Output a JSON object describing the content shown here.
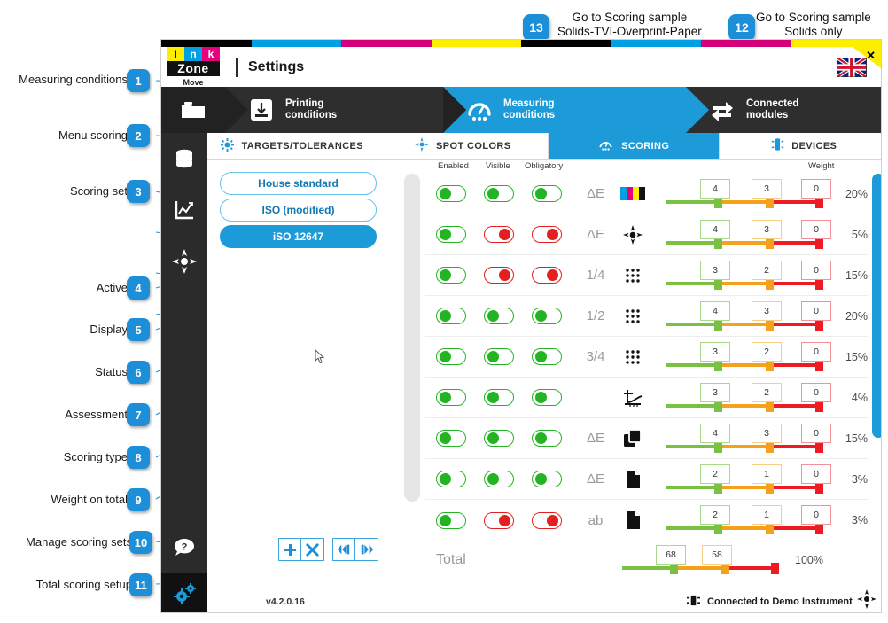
{
  "annotations": {
    "left_items": [
      {
        "n": "1",
        "label": "Measuring conditions"
      },
      {
        "n": "2",
        "label": "Menu scoring"
      },
      {
        "n": "3",
        "label": "Scoring set"
      },
      {
        "n": "4",
        "label": "Active"
      },
      {
        "n": "5",
        "label": "Display"
      },
      {
        "n": "6",
        "label": "Status"
      },
      {
        "n": "7",
        "label": "Assessment"
      },
      {
        "n": "8",
        "label": "Scoring type"
      },
      {
        "n": "9",
        "label": "Weight on total"
      },
      {
        "n": "10",
        "label": "Manage scoring sets"
      },
      {
        "n": "11",
        "label": "Total scoring setup"
      }
    ],
    "callouts": [
      {
        "n": "13",
        "line1": "Go to Scoring sample",
        "line2": "Solids-TVI-Overprint-Paper"
      },
      {
        "n": "12",
        "line1": "Go to Scoring sample",
        "line2": "Solids only"
      }
    ]
  },
  "window": {
    "logo": {
      "i": "I",
      "n": "n",
      "k": "k",
      "word": "Zone",
      "sub": "Move"
    },
    "title": "Settings",
    "flag_icon": "uk-flag-icon",
    "close_icon": "close-icon"
  },
  "mainnav": {
    "folder_icon": "folder-icon",
    "items": [
      {
        "label_1": "Printing",
        "label_2": "conditions",
        "icon": "printing-conditions-icon",
        "active": false
      },
      {
        "label_1": "Measuring",
        "label_2": "conditions",
        "icon": "measuring-conditions-icon",
        "active": true
      },
      {
        "label_1": "Connected",
        "label_2": "modules",
        "icon": "connected-modules-icon",
        "active": false
      }
    ]
  },
  "rail": {
    "icons": [
      "folder-icon",
      "database-icon",
      "chart-icon",
      "target-icon",
      "help-icon",
      "gears-icon"
    ]
  },
  "subtabs": [
    {
      "label": "TARGETS/TOLERANCES",
      "icon": "targets-tolerances-icon",
      "active": false
    },
    {
      "label": "SPOT COLORS",
      "icon": "spot-colors-icon",
      "active": false
    },
    {
      "label": "SCORING",
      "icon": "scoring-icon",
      "active": true
    },
    {
      "label": "DEVICES",
      "icon": "devices-icon",
      "active": false
    }
  ],
  "scoring_sets": [
    {
      "label": "House standard",
      "selected": false
    },
    {
      "label": "ISO (modified)",
      "selected": false
    },
    {
      "label": "iSO 12647",
      "selected": true
    }
  ],
  "manage_buttons": [
    {
      "name": "add-scoring-set-button",
      "glyph": "+"
    },
    {
      "name": "delete-scoring-set-button",
      "glyph": "✕"
    },
    {
      "name": "import-scoring-set-button",
      "glyph": "import"
    },
    {
      "name": "export-scoring-set-button",
      "glyph": "export"
    }
  ],
  "column_headers": {
    "enabled": "Enabled",
    "visible": "Visible",
    "obligatory": "Obligatory",
    "weight": "Weight"
  },
  "rows": [
    {
      "enabled": true,
      "visible": true,
      "obligatory": true,
      "assessment": "ΔE",
      "type_icon": "cmyk-bars-icon",
      "green": "4",
      "orange": "3",
      "red": "0",
      "weight": "20%"
    },
    {
      "enabled": true,
      "visible": false,
      "obligatory": false,
      "assessment": "ΔE",
      "type_icon": "spot-target-icon",
      "green": "4",
      "orange": "3",
      "red": "0",
      "weight": "5%"
    },
    {
      "enabled": true,
      "visible": false,
      "obligatory": false,
      "assessment": "1/4",
      "type_icon": "halftone-grid-icon",
      "green": "3",
      "orange": "2",
      "red": "0",
      "weight": "15%"
    },
    {
      "enabled": true,
      "visible": true,
      "obligatory": true,
      "assessment": "1/2",
      "type_icon": "halftone-grid-icon",
      "green": "4",
      "orange": "3",
      "red": "0",
      "weight": "20%"
    },
    {
      "enabled": true,
      "visible": true,
      "obligatory": true,
      "assessment": "3/4",
      "type_icon": "halftone-grid-icon",
      "green": "3",
      "orange": "2",
      "red": "0",
      "weight": "15%"
    },
    {
      "enabled": true,
      "visible": true,
      "obligatory": true,
      "assessment": "",
      "type_icon": "tvi-curve-icon",
      "green": "3",
      "orange": "2",
      "red": "0",
      "weight": "4%"
    },
    {
      "enabled": true,
      "visible": true,
      "obligatory": true,
      "assessment": "ΔE",
      "type_icon": "overprint-icon",
      "green": "4",
      "orange": "3",
      "red": "0",
      "weight": "15%"
    },
    {
      "enabled": true,
      "visible": true,
      "obligatory": true,
      "assessment": "ΔE",
      "type_icon": "paper-icon",
      "green": "2",
      "orange": "1",
      "red": "0",
      "weight": "3%"
    },
    {
      "enabled": true,
      "visible": false,
      "obligatory": false,
      "assessment": "ab",
      "type_icon": "paper-icon",
      "green": "2",
      "orange": "1",
      "red": "0",
      "weight": "3%"
    }
  ],
  "total_row": {
    "label": "Total",
    "green": "68",
    "orange": "58",
    "weight": "100%"
  },
  "statusbar": {
    "version": "v4.2.0.16",
    "connected_text": "Connected to Demo Instrument",
    "connected_icon": "device-icon",
    "right_icon": "target-icon"
  },
  "colors": {
    "accent": "#1d9bd8",
    "nav_dark": "#2e2e2e",
    "rail_dark": "#2b2b2b",
    "green": "#7ac143",
    "orange": "#f5a11b",
    "red": "#ed1c24",
    "toggle_on": "#22b422",
    "toggle_off": "#e22020"
  }
}
